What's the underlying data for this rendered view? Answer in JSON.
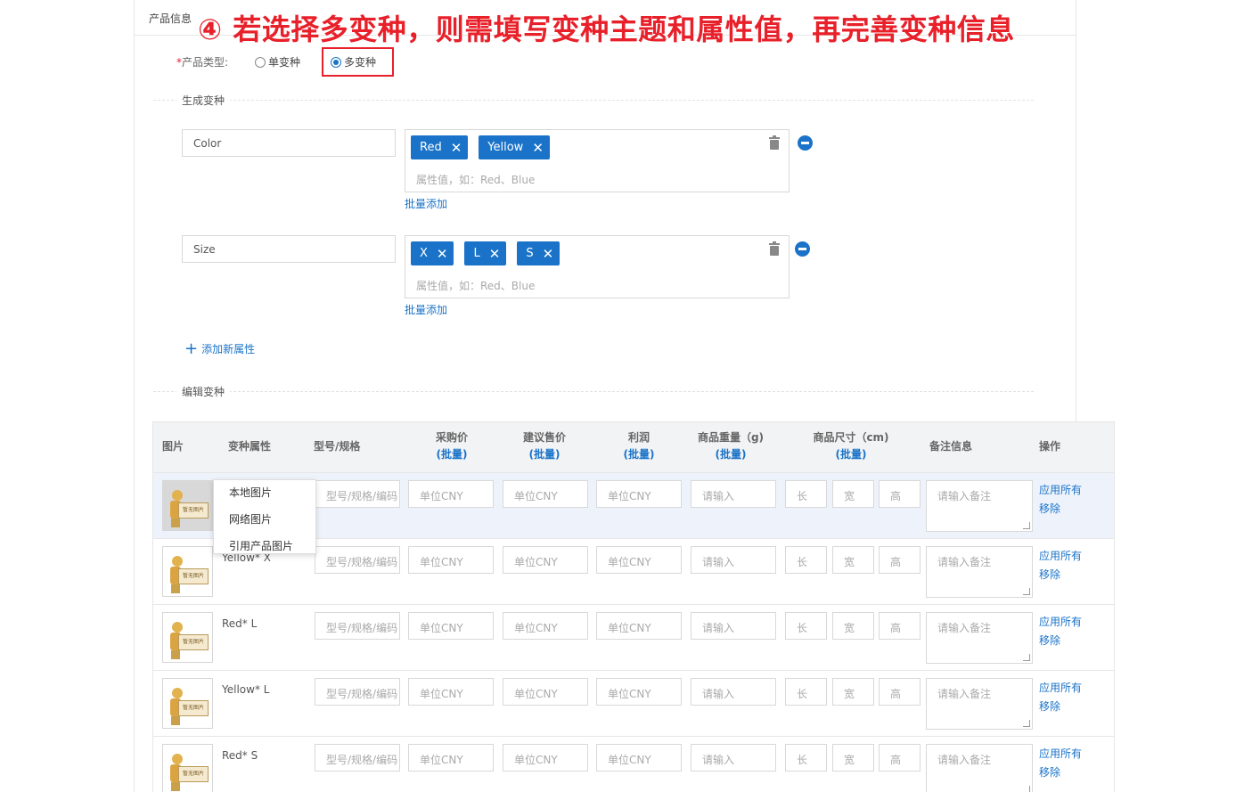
{
  "panel": {
    "label": "产品信息"
  },
  "banner": "④ 若选择多变种，则需填写变种主题和属性值，再完善变种信息",
  "product_type": {
    "label": "产品类型:",
    "options": [
      "单变种",
      "多变种"
    ],
    "selected": "多变种"
  },
  "generate": {
    "title": "生成变种",
    "attributes": [
      {
        "name": "Color",
        "values": [
          "Red",
          "Yellow"
        ],
        "placeholder": "属性值，如：Red、Blue",
        "bulk_add": "批量添加"
      },
      {
        "name": "Size",
        "values": [
          "X",
          "L",
          "S"
        ],
        "placeholder": "属性值，如：Red、Blue",
        "bulk_add": "批量添加"
      }
    ],
    "add_attribute": "添加新属性"
  },
  "edit": {
    "title": "编辑变种",
    "columns": {
      "image": "图片",
      "attrs": "变种属性",
      "model": "型号/规格",
      "purchase": "采购价",
      "retail": "建议售价",
      "profit": "利润",
      "weight": "商品重量（g)",
      "size": "商品尺寸（cm)",
      "note": "备注信息",
      "action": "操作",
      "bulk": "(批量)"
    },
    "placeholders": {
      "model": "型号/规格/编码",
      "price": "单位CNY",
      "weight": "请输入",
      "length": "长",
      "width": "宽",
      "height": "高",
      "note": "请输入备注"
    },
    "thumb_text": "暂无图片",
    "row_actions": {
      "apply": "应用所有",
      "remove": "移除"
    },
    "rows": [
      {
        "name": ""
      },
      {
        "name": "Yellow* X"
      },
      {
        "name": "Red* L"
      },
      {
        "name": "Yellow* L"
      },
      {
        "name": "Red* S"
      }
    ]
  },
  "image_menu": [
    "本地图片",
    "网络图片",
    "引用产品图片"
  ]
}
